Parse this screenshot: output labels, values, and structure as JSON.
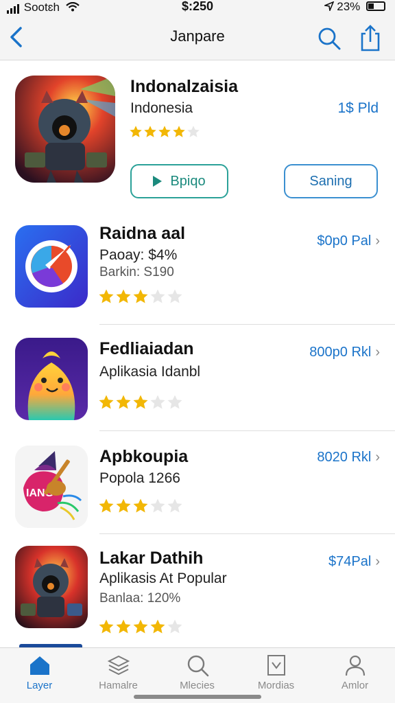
{
  "status_bar": {
    "carrier": "Sootɛh",
    "time": "$:250",
    "battery": "23%"
  },
  "nav": {
    "title": "Janpare"
  },
  "featured": {
    "name": "Indonalzaisia",
    "subtitle": "Indonesia",
    "price": "1$ Pld",
    "rating": 4,
    "play_label": "Bpiqo",
    "save_label": "Saning"
  },
  "apps": [
    {
      "name": "Raidna aal",
      "line1": "Paoay: $4%",
      "line2": "Barkin: S190",
      "price": "$0p0 Pal",
      "rating": 3
    },
    {
      "name": "Fedliaiadan",
      "line1": "Aplikasia Idanbl",
      "line2": "",
      "price": "800p0 Rkl",
      "rating": 3
    },
    {
      "name": "Apbkoupia",
      "line1": "Popola 1266",
      "line2": "",
      "price": "8020 Rkl",
      "rating": 3
    },
    {
      "name": "Lakar Dathih",
      "line1": "Aplikasis At Popular",
      "line2": "Banlaa: 120%",
      "price": "$74Pal",
      "rating": 4
    }
  ],
  "tabs": [
    {
      "label": "Layer",
      "icon": "home-icon",
      "active": true
    },
    {
      "label": "Hamalre",
      "icon": "stack-icon",
      "active": false
    },
    {
      "label": "Mlecies",
      "icon": "search-icon",
      "active": false
    },
    {
      "label": "Mordias",
      "icon": "document-icon",
      "active": false
    },
    {
      "label": "Amlor",
      "icon": "person-icon",
      "active": false
    }
  ],
  "colors": {
    "accent": "#1a73c9",
    "play_button": "#2aa198",
    "star": "#f2b705"
  }
}
